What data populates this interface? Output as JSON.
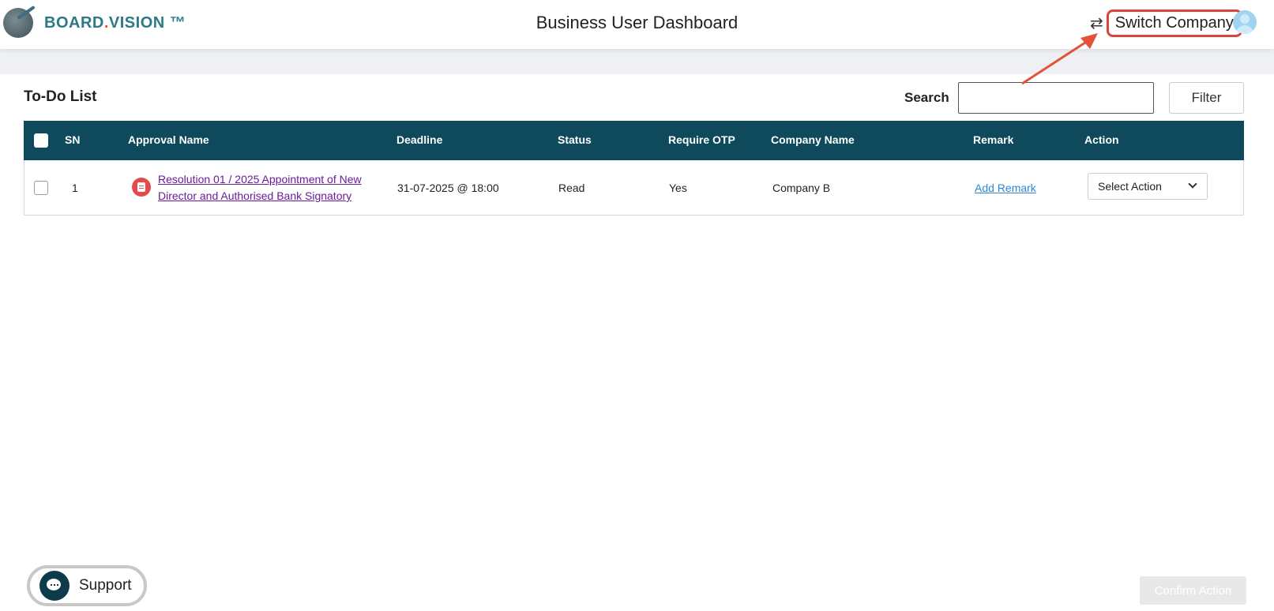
{
  "brand": {
    "name_part1": "BOARD",
    "name_dot": ".",
    "name_part2": "VISION",
    "tm": " ™"
  },
  "header": {
    "title": "Business User Dashboard",
    "switch_label": "Switch Company"
  },
  "todo": {
    "title": "To-Do List",
    "search_label": "Search",
    "search_value": "",
    "filter_label": "Filter",
    "columns": [
      "SN",
      "Approval Name",
      "Deadline",
      "Status",
      "Require OTP",
      "Company Name",
      "Remark",
      "Action"
    ],
    "rows": [
      {
        "sn": "1",
        "approval_name": "Resolution 01 / 2025 Appointment of New Director and Authorised Bank Signatory",
        "deadline": "31-07-2025 @ 18:00",
        "status": "Read",
        "require_otp": "Yes",
        "company_name": "Company B",
        "remark": "Add Remark",
        "action": "Select Action"
      }
    ]
  },
  "footer": {
    "support_label": "Support",
    "confirm_label": "Confirm Action"
  },
  "colors": {
    "table_header": "#0e4a5c",
    "accent_teal": "#2c7a86",
    "highlight_red": "#d9453a",
    "link_purple": "#6a1b9a",
    "link_blue": "#2b87d6"
  }
}
